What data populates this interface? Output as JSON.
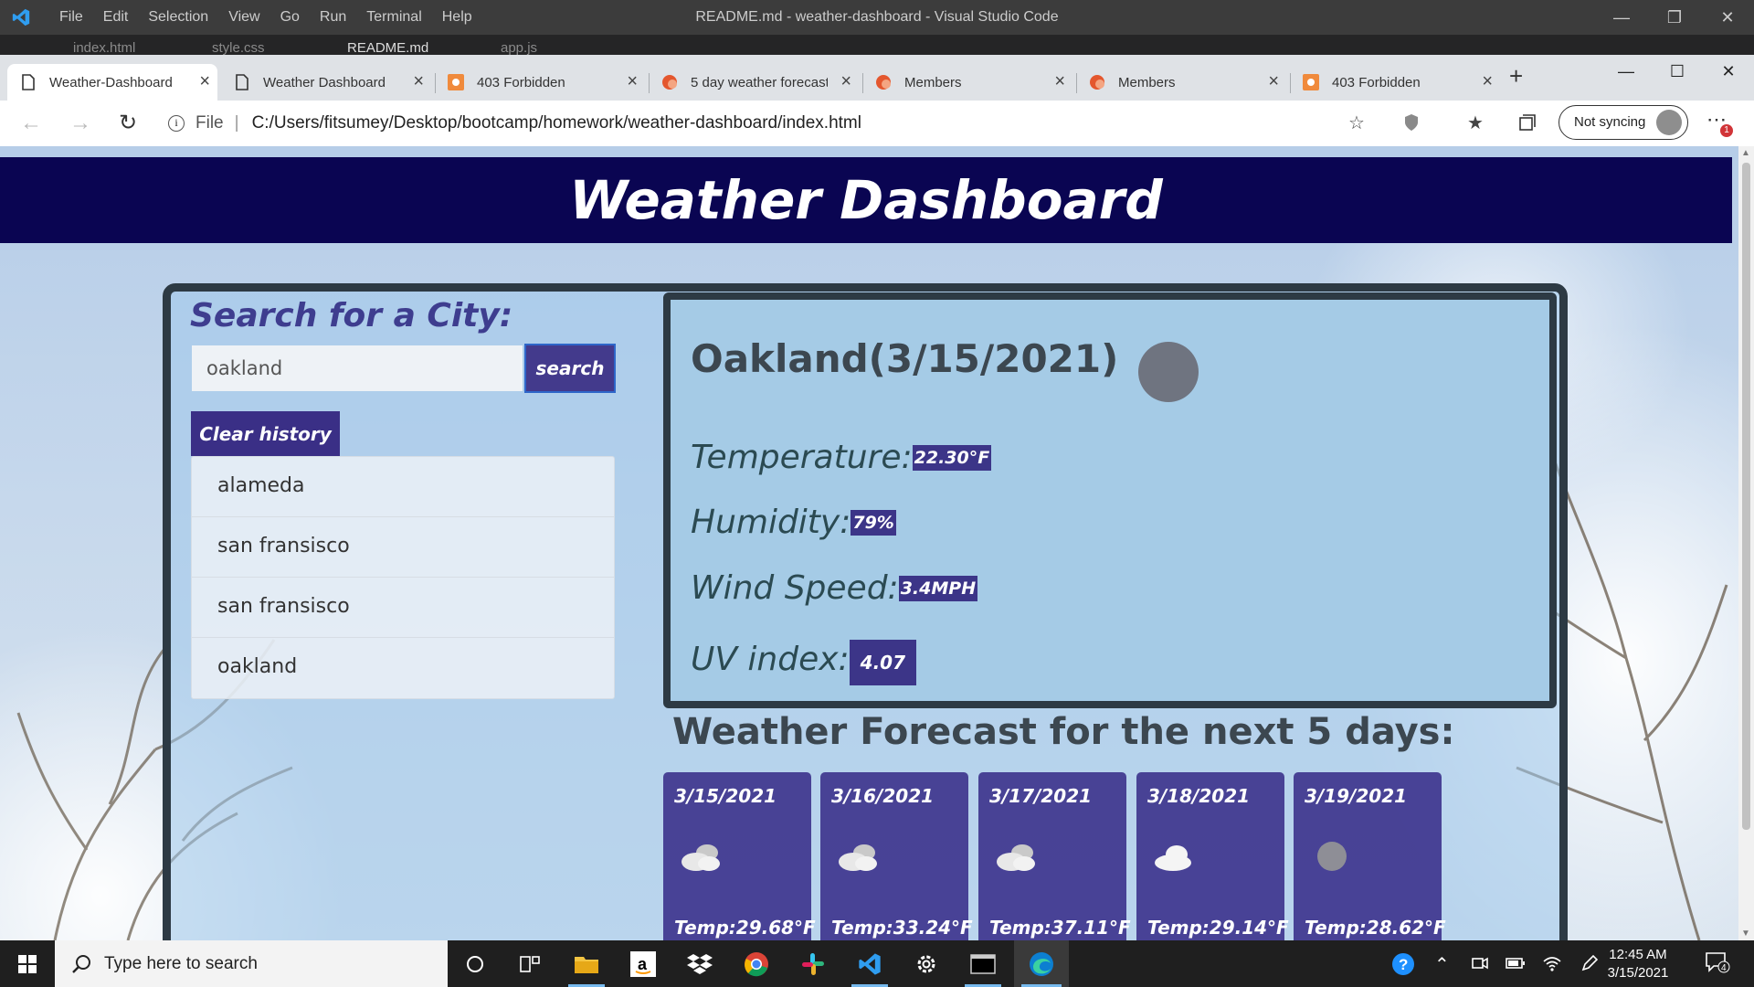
{
  "vscode": {
    "title": "README.md - weather-dashboard - Visual Studio Code",
    "menu": [
      "File",
      "Edit",
      "Selection",
      "View",
      "Go",
      "Run",
      "Terminal",
      "Help"
    ],
    "tabs": [
      "index.html",
      "style.css",
      "README.md",
      "app.js"
    ]
  },
  "browser": {
    "tabs": [
      {
        "label": "Weather-Dashboard",
        "active": true
      },
      {
        "label": "Weather Dashboard",
        "active": false
      },
      {
        "label": "403 Forbidden",
        "active": false
      },
      {
        "label": "5 day weather forecast",
        "active": false
      },
      {
        "label": "Members",
        "active": false
      },
      {
        "label": "Members",
        "active": false
      },
      {
        "label": "403 Forbidden",
        "active": false
      }
    ],
    "address": {
      "file_label": "File",
      "url": "C:/Users/fitsumey/Desktop/bootcamp/homework/weather-dashboard/index.html"
    },
    "sync_label": "Not syncing",
    "notification_count": "1"
  },
  "page": {
    "header_title": "Weather Dashboard",
    "search": {
      "title": "Search for a City:",
      "input_value": "oakland",
      "button_label": "search",
      "clear_label": "Clear history"
    },
    "history": [
      "alameda",
      "san fransisco",
      "san fransisco",
      "oakland"
    ],
    "current": {
      "city_heading": "Oakland(3/15/2021)",
      "temperature_label": "Temperature:",
      "temperature_value": "22.30°F",
      "humidity_label": "Humidity:",
      "humidity_value": "79%",
      "wind_label": "Wind Speed:",
      "wind_value": "3.4MPH",
      "uv_label": "UV index:",
      "uv_value": "4.07"
    },
    "forecast_title": "Weather Forecast for the next 5 days:",
    "forecast": [
      {
        "date": "3/15/2021",
        "icon": "clouds-icon",
        "temp": "Temp:29.68°F"
      },
      {
        "date": "3/16/2021",
        "icon": "clouds-icon",
        "temp": "Temp:33.24°F"
      },
      {
        "date": "3/17/2021",
        "icon": "clouds-icon",
        "temp": "Temp:37.11°F"
      },
      {
        "date": "3/18/2021",
        "icon": "cloud-icon",
        "temp": "Temp:29.14°F"
      },
      {
        "date": "3/19/2021",
        "icon": "moon-icon",
        "temp": "Temp:28.62°F"
      }
    ]
  },
  "taskbar": {
    "search_placeholder": "Type here to search",
    "time": "12:45 AM",
    "date": "3/15/2021",
    "notification_count": "4"
  },
  "colors": {
    "header_bg": "#0a0552",
    "accent_purple": "#3c3588",
    "box_border": "#2d3a44"
  }
}
